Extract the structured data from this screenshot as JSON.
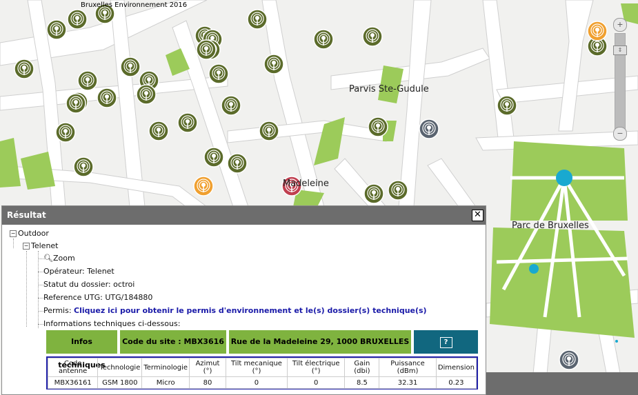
{
  "map": {
    "credit": "Bruxelles Environnement 2016",
    "labels": {
      "parvis": "Parvis Ste-Gudule",
      "madeleine": "Madeleine",
      "parc": "Parc de Bruxelles"
    },
    "colors": {
      "antenna_green": "#5b6b2a",
      "antenna_orange": "#f0a030",
      "antenna_grey": "#5a6470",
      "antenna_selected": "#c04050",
      "park": "#9ccb5a",
      "park_marker": "#19a9d0"
    },
    "zoom": {
      "plus": "+",
      "minus": "−"
    }
  },
  "panel": {
    "title": "Résultat",
    "close_icon": "close-icon",
    "tree": {
      "outdoor": "Outdoor",
      "operator_node": "Telenet",
      "zoom": "Zoom",
      "operateur": "Opérateur: Telenet",
      "statut": "Statut du dossier: octroi",
      "reference": "Reference UTG: UTG/184880",
      "permis_label": "Permis:",
      "permis_link": "Cliquez ici pour obtenir le permis d'environnement et le(s) dossier(s) technique(s)",
      "infos": "Informations techniques ci-dessous:"
    },
    "infobar": {
      "infos_techniques": "Infos techniques",
      "code_site": "Code du site : MBX3616",
      "adresse": "Rue de la Madeleine 29, 1000 BRUXELLES",
      "help": "?"
    },
    "table": {
      "headers": [
        "Code antenne",
        "Technologie",
        "Terminologie",
        "Azimut (°)",
        "Tilt mecanique (°)",
        "Tilt électrique (°)",
        "Gain (dbi)",
        "Puissance (dBm)",
        "Dimension"
      ],
      "rows": [
        [
          "MBX36161",
          "GSM 1800",
          "Micro",
          "80",
          "0",
          "0",
          "8.5",
          "32.31",
          "0.23"
        ]
      ]
    }
  }
}
